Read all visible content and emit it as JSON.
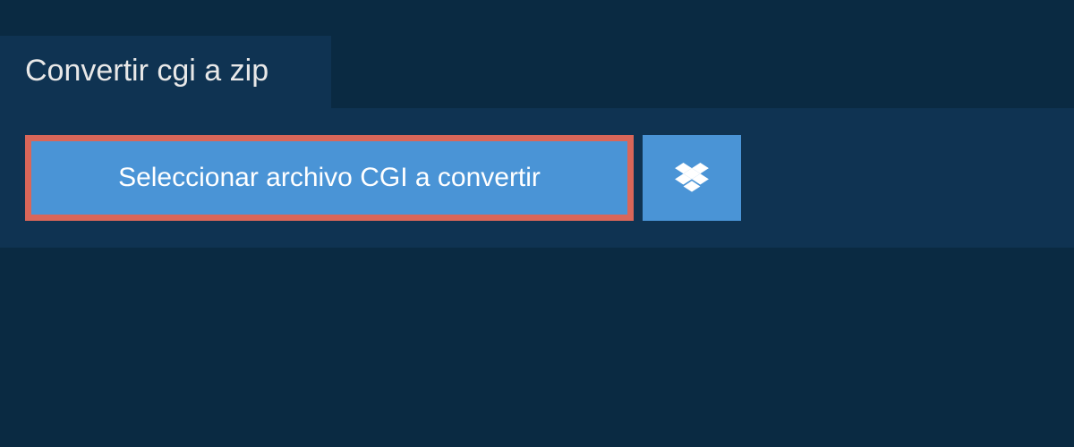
{
  "tab": {
    "title": "Convertir cgi a zip"
  },
  "actions": {
    "select_label": "Seleccionar archivo CGI a convertir",
    "dropbox_icon_name": "dropbox-icon"
  },
  "colors": {
    "background": "#0a2a42",
    "panel": "#0f3352",
    "button_primary": "#4a94d6",
    "button_highlight_border": "#d96659",
    "text_light": "#ffffff",
    "text_tab": "#e8e8e8"
  }
}
